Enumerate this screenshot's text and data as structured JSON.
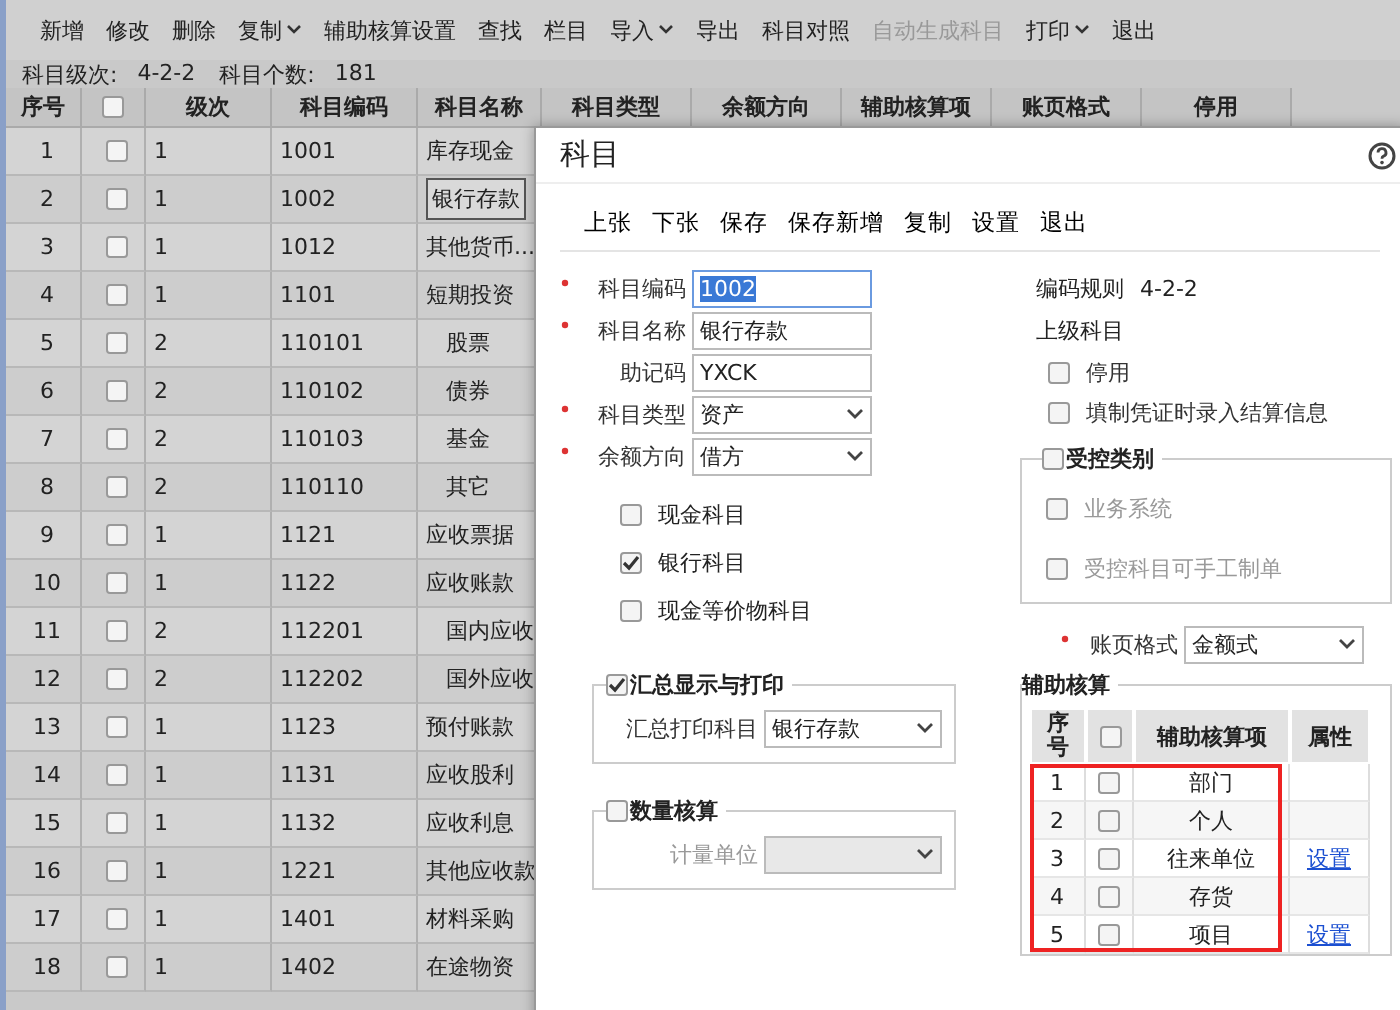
{
  "toolbar": [
    {
      "label": "新增",
      "dropdown": false,
      "disabled": false
    },
    {
      "label": "修改",
      "dropdown": false,
      "disabled": false
    },
    {
      "label": "删除",
      "dropdown": false,
      "disabled": false
    },
    {
      "label": "复制",
      "dropdown": true,
      "disabled": false
    },
    {
      "label": "辅助核算设置",
      "dropdown": false,
      "disabled": false
    },
    {
      "label": "查找",
      "dropdown": false,
      "disabled": false
    },
    {
      "label": "栏目",
      "dropdown": false,
      "disabled": false
    },
    {
      "label": "导入",
      "dropdown": true,
      "disabled": false
    },
    {
      "label": "导出",
      "dropdown": false,
      "disabled": false
    },
    {
      "label": "科目对照",
      "dropdown": false,
      "disabled": false
    },
    {
      "label": "自动生成科目",
      "dropdown": false,
      "disabled": true
    },
    {
      "label": "打印",
      "dropdown": true,
      "disabled": false
    },
    {
      "label": "退出",
      "dropdown": false,
      "disabled": false
    }
  ],
  "info": [
    {
      "label": "科目级次:",
      "value": "4-2-2"
    },
    {
      "label": "科目个数:",
      "value": "181"
    }
  ],
  "table": {
    "all_checked": false,
    "columns": [
      "序号",
      "级次",
      "科目编码",
      "科目名称",
      "科目类型",
      "余额方向",
      "辅助核算项",
      "账页格式",
      "停用"
    ],
    "rows": [
      {
        "no": "1",
        "checked": false,
        "level": "1",
        "code": "1001",
        "name": "库存现金",
        "selected": false
      },
      {
        "no": "2",
        "checked": false,
        "level": "1",
        "code": "1002",
        "name": "银行存款",
        "selected": true
      },
      {
        "no": "3",
        "checked": false,
        "level": "1",
        "code": "1012",
        "name": "其他货币...",
        "selected": false
      },
      {
        "no": "4",
        "checked": false,
        "level": "1",
        "code": "1101",
        "name": "短期投资",
        "selected": false,
        "children": [
          {
            "no": "5",
            "checked": false,
            "level": "2",
            "code": "110101",
            "name": "股票",
            "selected": false
          },
          {
            "no": "6",
            "checked": false,
            "level": "2",
            "code": "110102",
            "name": "债券",
            "selected": false
          },
          {
            "no": "7",
            "checked": false,
            "level": "2",
            "code": "110103",
            "name": "基金",
            "selected": false
          },
          {
            "no": "8",
            "checked": false,
            "level": "2",
            "code": "110110",
            "name": "其它",
            "selected": false
          }
        ]
      },
      {
        "no": "9",
        "checked": false,
        "level": "1",
        "code": "1121",
        "name": "应收票据",
        "selected": false
      },
      {
        "no": "10",
        "checked": false,
        "level": "1",
        "code": "1122",
        "name": "应收账款",
        "selected": false,
        "children": [
          {
            "no": "11",
            "checked": false,
            "level": "2",
            "code": "112201",
            "name": "国内应收",
            "selected": false
          },
          {
            "no": "12",
            "checked": false,
            "level": "2",
            "code": "112202",
            "name": "国外应收",
            "selected": false
          }
        ]
      },
      {
        "no": "13",
        "checked": false,
        "level": "1",
        "code": "1123",
        "name": "预付账款",
        "selected": false
      },
      {
        "no": "14",
        "checked": false,
        "level": "1",
        "code": "1131",
        "name": "应收股利",
        "selected": false
      },
      {
        "no": "15",
        "checked": false,
        "level": "1",
        "code": "1132",
        "name": "应收利息",
        "selected": false
      },
      {
        "no": "16",
        "checked": false,
        "level": "1",
        "code": "1221",
        "name": "其他应收款",
        "selected": false
      },
      {
        "no": "17",
        "checked": false,
        "level": "1",
        "code": "1401",
        "name": "材料采购",
        "selected": false
      },
      {
        "no": "18",
        "checked": false,
        "level": "1",
        "code": "1402",
        "name": "在途物资",
        "selected": false
      }
    ]
  },
  "dialog": {
    "title": "科目",
    "toolbar": [
      "上张",
      "下张",
      "保存",
      "保存新增",
      "复制",
      "设置",
      "退出"
    ],
    "fields": [
      {
        "label": "科目编码",
        "required": true,
        "kind": "text",
        "value": "1002",
        "focused": true
      },
      {
        "label": "科目名称",
        "required": true,
        "kind": "text",
        "value": "银行存款",
        "focused": false
      },
      {
        "label": "助记码",
        "required": false,
        "kind": "text",
        "value": "YXCK",
        "focused": false
      },
      {
        "label": "科目类型",
        "required": true,
        "kind": "select",
        "value": "资产",
        "focused": false
      },
      {
        "label": "余额方向",
        "required": true,
        "kind": "select",
        "value": "借方",
        "focused": false
      }
    ],
    "options": [
      {
        "label": "现金科目",
        "checked": false
      },
      {
        "label": "银行科目",
        "checked": true
      },
      {
        "label": "现金等价物科目",
        "checked": false
      }
    ],
    "summary_group": {
      "title": "汇总显示与打印",
      "checked": true,
      "field": {
        "label": "汇总打印科目",
        "value": "银行存款",
        "disabled": false
      }
    },
    "quantity_group": {
      "title": "数量核算",
      "checked": false,
      "field": {
        "label": "计量单位",
        "disabled": true
      }
    },
    "code_rule": {
      "label": "编码规则",
      "value": "4-2-2"
    },
    "parent_label": "上级科目",
    "right_options": [
      {
        "label": "停用",
        "checked": false
      },
      {
        "label": "填制凭证时录入结算信息",
        "checked": false
      }
    ],
    "control_group": {
      "title": "受控类别",
      "checked": false,
      "options": [
        {
          "label": "业务系统",
          "checked": false,
          "disabled": true
        },
        {
          "label": "受控科目可手工制单",
          "checked": false,
          "disabled": true
        }
      ]
    },
    "ledger_format": {
      "label": "账页格式",
      "required": true,
      "value": "金额式"
    },
    "aux": {
      "title": "辅助核算",
      "all_checked": false,
      "columns": [
        "序号",
        "辅助核算项",
        "属性"
      ],
      "highlighted": true,
      "rows": [
        {
          "no": "1",
          "checked": false,
          "item": "部门"
        },
        {
          "no": "2",
          "checked": false,
          "item": "个人"
        },
        {
          "no": "3",
          "checked": false,
          "item": "往来单位",
          "link": "设置"
        },
        {
          "no": "4",
          "checked": false,
          "item": "存货"
        },
        {
          "no": "5",
          "checked": false,
          "item": "项目",
          "link": "设置"
        }
      ]
    }
  }
}
